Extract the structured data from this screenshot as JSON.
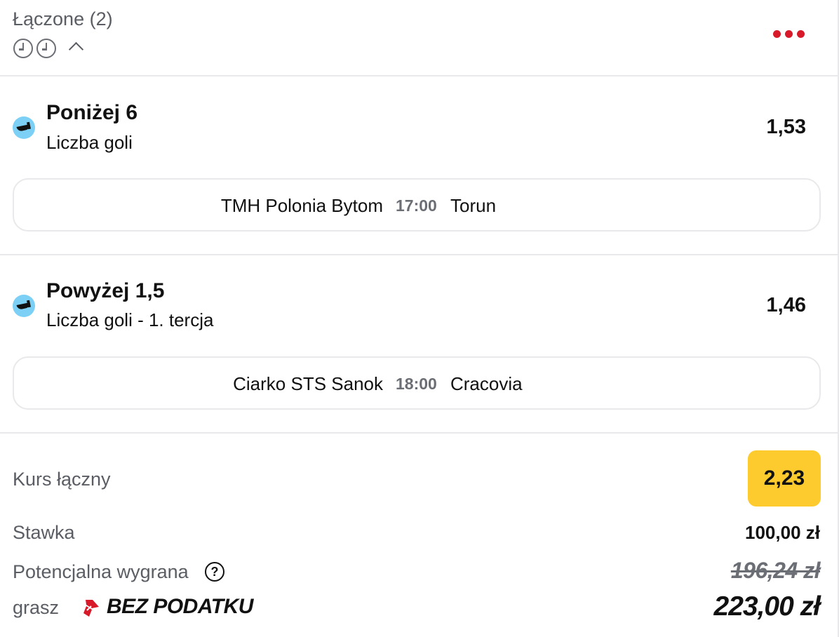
{
  "header": {
    "title": "Łączone (2)",
    "icons": [
      "clock-icon",
      "clock-icon",
      "chevron-up-icon",
      "more-icon"
    ]
  },
  "selections": [
    {
      "sport_icon": "hockey-icon",
      "title": "Poniżej 6",
      "market": "Liczba goli",
      "odd": "1,53",
      "event": {
        "home": "TMH Polonia Bytom",
        "time": "17:00",
        "away": "Torun"
      }
    },
    {
      "sport_icon": "hockey-icon",
      "title": "Powyżej 1,5",
      "market": "Liczba goli - 1. tercja",
      "odd": "1,46",
      "event": {
        "home": "Ciarko STS Sanok",
        "time": "18:00",
        "away": "Cracovia"
      }
    }
  ],
  "summary": {
    "total_odds_label": "Kurs łączny",
    "total_odds": "2,23",
    "stake_label": "Stawka",
    "stake": "100,00 zł",
    "potential_win_label": "Potencjalna wygrana",
    "potential_win_old": "196,24 zł",
    "grasz_label": "grasz",
    "no_tax_brand": "BEZ PODATKU",
    "potential_win": "223,00 zł"
  },
  "colors": {
    "accent_red": "#d7192a",
    "odds_highlight": "#fdcb2e",
    "hockey_icon_bg": "#7dd0f5",
    "muted_text": "#5a5d63"
  }
}
